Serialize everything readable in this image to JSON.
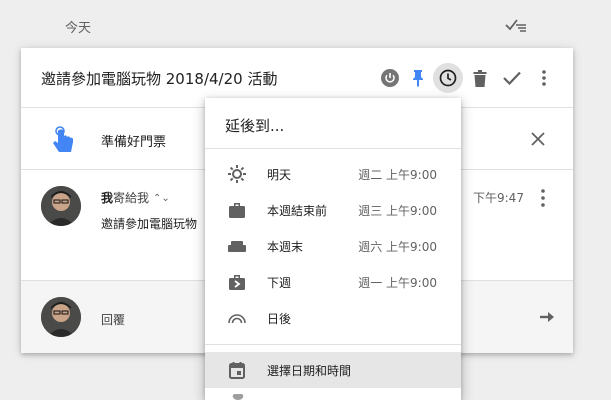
{
  "section": {
    "title": "今天",
    "sweep_icon": "sweep-done-icon"
  },
  "card": {
    "title": "邀請參加電腦玩物 2018/4/20 活動",
    "toolbar_icons": [
      "power-icon",
      "pin-icon",
      "snooze-clock-icon",
      "trash-icon",
      "done-check-icon",
      "more-vert-icon"
    ],
    "reminder": {
      "text": "準備好門票",
      "icon": "hand-point-icon",
      "close_icon": "close-icon"
    },
    "email": {
      "from_name": "我",
      "to_text": "寄給我",
      "expand_icon": "chevron-up-down-icon",
      "snippet": "邀請參加電腦玩物",
      "time": "下午9:47"
    },
    "reply": {
      "label": "回覆",
      "arrow_icon": "arrow-right-icon"
    }
  },
  "snooze_menu": {
    "title": "延後到...",
    "items": [
      {
        "label": "明天",
        "when": "週二 上午9:00",
        "icon": "sun-icon"
      },
      {
        "label": "本週結束前",
        "when": "週三 上午9:00",
        "icon": "briefcase-icon"
      },
      {
        "label": "本週末",
        "when": "週六 上午9:00",
        "icon": "couch-icon"
      },
      {
        "label": "下週",
        "when": "週一 上午9:00",
        "icon": "briefcase-next-icon"
      },
      {
        "label": "日後",
        "when": "",
        "icon": "rainbow-icon"
      }
    ],
    "pick": {
      "label": "選擇日期和時間",
      "icon": "calendar-icon"
    }
  },
  "colors": {
    "accent_blue": "#4285f4",
    "icon_grey": "#616161",
    "active_bg": "#e0e0e0"
  }
}
